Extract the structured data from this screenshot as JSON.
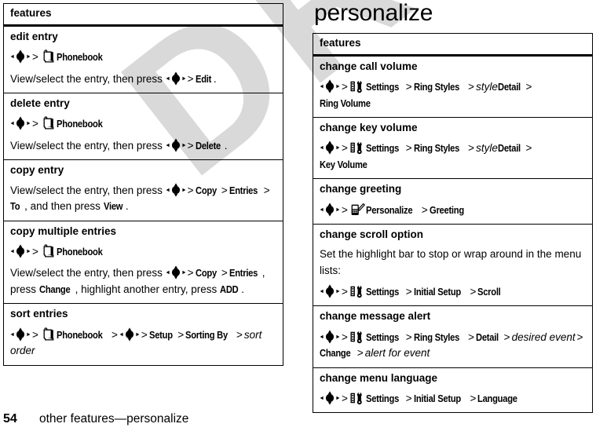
{
  "page": {
    "title": "personalize",
    "folio": "54",
    "running_head": "other features—personalize",
    "watermark": "DRAFT"
  },
  "icons": {
    "nav_key": "navigation-key-icon",
    "phonebook": "phonebook-book-icon",
    "settings": "settings-tools-icon",
    "personalize": "personalize-phone-pencil-icon"
  },
  "left_table": {
    "header": "features",
    "rows": [
      {
        "name": "edit entry",
        "path": [
          {
            "t": "navkey"
          },
          {
            "t": "sep",
            "v": ">"
          },
          {
            "t": "phonebook"
          },
          {
            "t": "mi",
            "v": "Phonebook"
          }
        ],
        "body": [
          {
            "t": "plain",
            "v": "View/select the entry, then press "
          },
          {
            "t": "navkey"
          },
          {
            "t": "sep",
            "v": ">"
          },
          {
            "t": "mi",
            "v": "Edit"
          },
          {
            "t": "plain",
            "v": "."
          }
        ]
      },
      {
        "name": "delete entry",
        "path": [
          {
            "t": "navkey"
          },
          {
            "t": "sep",
            "v": ">"
          },
          {
            "t": "phonebook"
          },
          {
            "t": "mi",
            "v": "Phonebook"
          }
        ],
        "body": [
          {
            "t": "plain",
            "v": "View/select the entry, then press "
          },
          {
            "t": "navkey"
          },
          {
            "t": "sep",
            "v": ">"
          },
          {
            "t": "mi",
            "v": "Delete"
          },
          {
            "t": "plain",
            "v": "."
          }
        ]
      },
      {
        "name": "copy entry",
        "path": [],
        "body": [
          {
            "t": "plain",
            "v": "View/select the entry, then press "
          },
          {
            "t": "navkey"
          },
          {
            "t": "sep",
            "v": ">"
          },
          {
            "t": "mi",
            "v": "Copy"
          },
          {
            "t": "sep",
            "v": ">"
          },
          {
            "t": "mi",
            "v": "Entries"
          },
          {
            "t": "sep",
            "v": ">"
          },
          {
            "t": "mi",
            "v": "To"
          },
          {
            "t": "plain",
            "v": " , and then press "
          },
          {
            "t": "mi",
            "v": "View"
          },
          {
            "t": "plain",
            "v": "."
          }
        ]
      },
      {
        "name": "copy multiple entries",
        "path": [
          {
            "t": "navkey"
          },
          {
            "t": "sep",
            "v": ">"
          },
          {
            "t": "phonebook"
          },
          {
            "t": "mi",
            "v": "Phonebook"
          }
        ],
        "body": [
          {
            "t": "plain",
            "v": "View/select the entry, then press "
          },
          {
            "t": "navkey"
          },
          {
            "t": "sep",
            "v": ">"
          },
          {
            "t": "mi",
            "v": "Copy"
          },
          {
            "t": "sep",
            "v": ">"
          },
          {
            "t": "mi",
            "v": "Entries"
          },
          {
            "t": "plain",
            "v": ", press "
          },
          {
            "t": "mi",
            "v": "Change"
          },
          {
            "t": "plain",
            "v": ", highlight another entry, press "
          },
          {
            "t": "mi",
            "v": "ADD"
          },
          {
            "t": "plain",
            "v": "."
          }
        ]
      },
      {
        "name": "sort entries",
        "path": [
          {
            "t": "navkey"
          },
          {
            "t": "sep",
            "v": ">"
          },
          {
            "t": "phonebook"
          },
          {
            "t": "mi",
            "v": "Phonebook"
          },
          {
            "t": "sep",
            "v": ">"
          },
          {
            "t": "navkey"
          },
          {
            "t": "sep",
            "v": ">"
          },
          {
            "t": "mi",
            "v": "Setup"
          },
          {
            "t": "sep",
            "v": ">"
          },
          {
            "t": "mi",
            "v": "Sorting By"
          },
          {
            "t": "sep",
            "v": ">"
          },
          {
            "t": "var",
            "v": "sort order"
          }
        ],
        "body": []
      }
    ]
  },
  "right_table": {
    "header": "features",
    "rows": [
      {
        "name": "change call volume",
        "path": [
          {
            "t": "navkey"
          },
          {
            "t": "sep",
            "v": ">"
          },
          {
            "t": "settings"
          },
          {
            "t": "mi",
            "v": "Settings"
          },
          {
            "t": "sep",
            "v": ">"
          },
          {
            "t": "mi",
            "v": "Ring Styles"
          },
          {
            "t": "sep",
            "v": ">"
          },
          {
            "t": "var",
            "v": "style"
          },
          {
            "t": "mi",
            "v": "Detail"
          },
          {
            "t": "sep",
            "v": ">"
          },
          {
            "t": "mi",
            "v": "Ring Volume"
          }
        ],
        "body": []
      },
      {
        "name": "change key volume",
        "path": [
          {
            "t": "navkey"
          },
          {
            "t": "sep",
            "v": ">"
          },
          {
            "t": "settings"
          },
          {
            "t": "mi",
            "v": "Settings"
          },
          {
            "t": "sep",
            "v": ">"
          },
          {
            "t": "mi",
            "v": "Ring Styles"
          },
          {
            "t": "sep",
            "v": ">"
          },
          {
            "t": "var",
            "v": "style"
          },
          {
            "t": "mi",
            "v": "Detail"
          },
          {
            "t": "sep",
            "v": ">"
          },
          {
            "t": "mi",
            "v": "Key Volume"
          }
        ],
        "body": []
      },
      {
        "name": "change greeting",
        "path": [
          {
            "t": "navkey"
          },
          {
            "t": "sep",
            "v": ">"
          },
          {
            "t": "personalize"
          },
          {
            "t": "mi",
            "v": "Personalize"
          },
          {
            "t": "sep",
            "v": ">"
          },
          {
            "t": "mi",
            "v": "Greeting"
          }
        ],
        "body": []
      },
      {
        "name": "change scroll option",
        "note": "Set the highlight bar to stop or wrap around in the menu lists:",
        "path": [
          {
            "t": "navkey"
          },
          {
            "t": "sep",
            "v": ">"
          },
          {
            "t": "settings"
          },
          {
            "t": "mi",
            "v": "Settings"
          },
          {
            "t": "sep",
            "v": ">"
          },
          {
            "t": "mi",
            "v": "Initial Setup"
          },
          {
            "t": "sep",
            "v": ">"
          },
          {
            "t": "mi",
            "v": "Scroll"
          }
        ],
        "body": []
      },
      {
        "name": "change message alert",
        "path": [
          {
            "t": "navkey"
          },
          {
            "t": "sep",
            "v": ">"
          },
          {
            "t": "settings"
          },
          {
            "t": "mi",
            "v": "Settings"
          },
          {
            "t": "sep",
            "v": ">"
          },
          {
            "t": "mi",
            "v": "Ring Styles"
          },
          {
            "t": "sep",
            "v": ">"
          },
          {
            "t": "mi",
            "v": "Detail"
          },
          {
            "t": "sep",
            "v": ">"
          },
          {
            "t": "var",
            "v": "desired event"
          },
          {
            "t": "sep",
            "v": ">"
          },
          {
            "t": "mi",
            "v": "Change"
          },
          {
            "t": "sep",
            "v": ">"
          },
          {
            "t": "var",
            "v": "alert for event"
          }
        ],
        "body": []
      },
      {
        "name": "change menu language",
        "path": [
          {
            "t": "navkey"
          },
          {
            "t": "sep",
            "v": ">"
          },
          {
            "t": "settings"
          },
          {
            "t": "mi",
            "v": "Settings"
          },
          {
            "t": "sep",
            "v": ">"
          },
          {
            "t": "mi",
            "v": "Initial Setup"
          },
          {
            "t": "sep",
            "v": ">"
          },
          {
            "t": "mi",
            "v": "Language"
          }
        ],
        "body": []
      }
    ]
  }
}
